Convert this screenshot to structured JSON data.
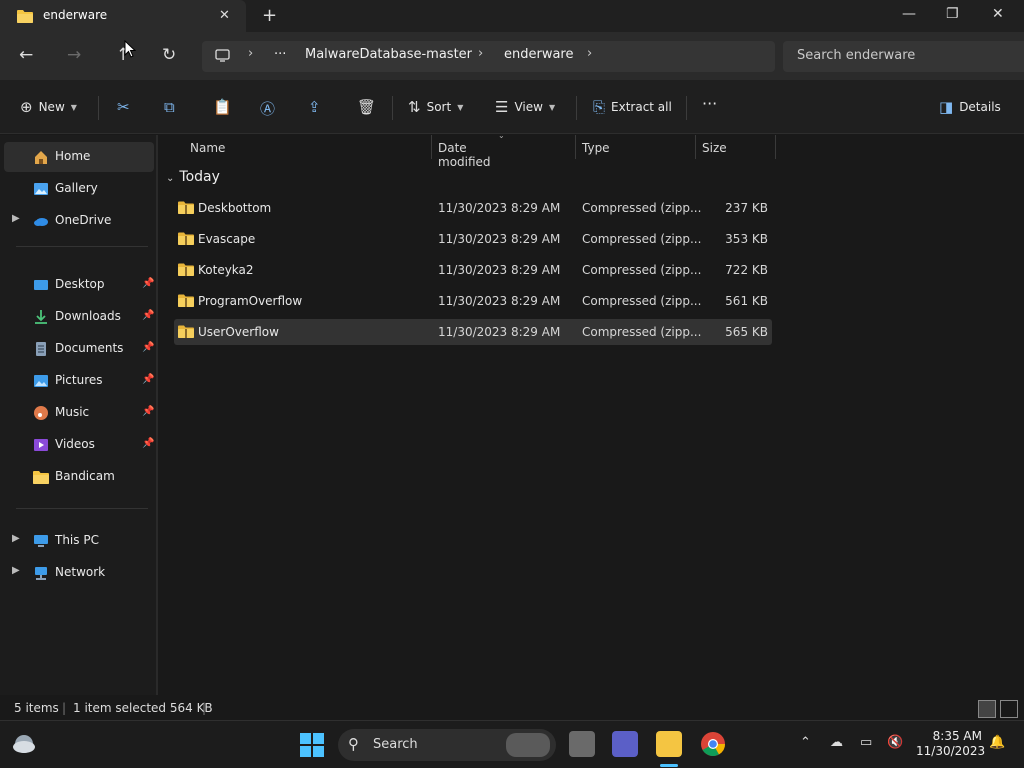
{
  "tab": {
    "title": "enderware",
    "close": "✕",
    "new": "+"
  },
  "window": {
    "minimize": "—",
    "restore": "❐",
    "close": "✕"
  },
  "address": {
    "back": "←",
    "forward": "→",
    "up": "↑",
    "refresh": "↻",
    "more": "···",
    "crumbs": [
      "MalwareDatabase-master",
      "enderware"
    ],
    "sep": "›"
  },
  "search": {
    "placeholder": "Search enderware"
  },
  "commands": {
    "new": "New",
    "sort": "Sort",
    "view": "View",
    "extract_all": "Extract all",
    "more": "···",
    "details": "Details"
  },
  "sidebar": {
    "home": "Home",
    "gallery": "Gallery",
    "onedrive": "OneDrive",
    "desktop": "Desktop",
    "downloads": "Downloads",
    "documents": "Documents",
    "pictures": "Pictures",
    "music": "Music",
    "videos": "Videos",
    "bandicam": "Bandicam",
    "thispc": "This PC",
    "network": "Network"
  },
  "columns": {
    "name": "Name",
    "date": "Date modified",
    "type": "Type",
    "size": "Size"
  },
  "group_label": "Today",
  "files": [
    {
      "name": "Deskbottom",
      "date": "11/30/2023 8:29 AM",
      "type": "Compressed (zipp...",
      "size": "237 KB"
    },
    {
      "name": "Evascape",
      "date": "11/30/2023 8:29 AM",
      "type": "Compressed (zipp...",
      "size": "353 KB"
    },
    {
      "name": "Koteyka2",
      "date": "11/30/2023 8:29 AM",
      "type": "Compressed (zipp...",
      "size": "722 KB"
    },
    {
      "name": "ProgramOverflow",
      "date": "11/30/2023 8:29 AM",
      "type": "Compressed (zipp...",
      "size": "561 KB"
    },
    {
      "name": "UserOverflow",
      "date": "11/30/2023 8:29 AM",
      "type": "Compressed (zipp...",
      "size": "565 KB"
    }
  ],
  "status": {
    "count": "5 items",
    "selection": "1 item selected  564 KB"
  },
  "taskbar": {
    "search": "Search",
    "time": "8:35 AM",
    "date": "11/30/2023"
  },
  "colors": {
    "accent": "#4cc2ff",
    "folder": "#f4c542"
  }
}
